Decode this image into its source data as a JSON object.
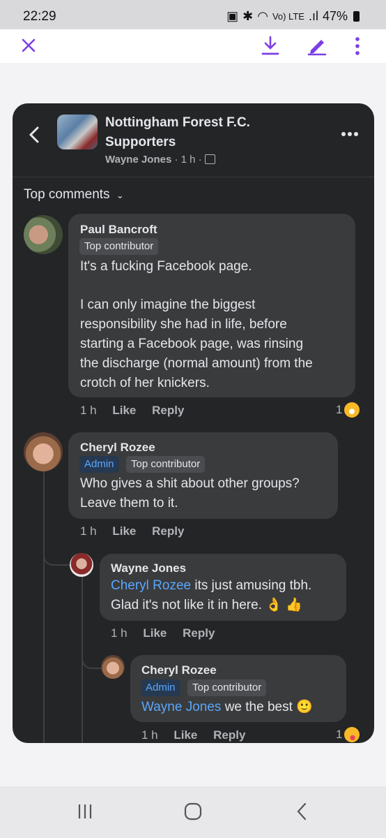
{
  "status_bar": {
    "time": "22:29",
    "network": "Vo) LTE",
    "battery": "47%"
  },
  "viewer_toolbar": {
    "close_icon": "close-icon",
    "download_icon": "download-icon",
    "edit_icon": "pencil-icon",
    "more_icon": "vertical-dots-icon",
    "accent_color": "#7b3fe4"
  },
  "post_header": {
    "group_name_line1": "Nottingham Forest F.C.",
    "group_name_line2": "Supporters",
    "author": "Wayne Jones",
    "time": "1 h",
    "separator": "·"
  },
  "sort": {
    "label": "Top comments"
  },
  "comments": [
    {
      "name": "Paul Bancroft",
      "badges": [
        "Top contributor"
      ],
      "lines": [
        "It's a fucking Facebook page.",
        "",
        "I can only imagine the biggest",
        "responsibility she had in life, before",
        "starting a Facebook page, was rinsing",
        "the discharge (normal amount) from the",
        "crotch of her knickers."
      ],
      "time": "1 h",
      "like": "Like",
      "reply": "Reply",
      "reaction_count": "1"
    },
    {
      "name": "Cheryl Rozee",
      "badges": [
        "Admin",
        "Top contributor"
      ],
      "lines": [
        "Who gives a shit about other groups?",
        "Leave them to it."
      ],
      "time": "1 h",
      "like": "Like",
      "reply": "Reply"
    },
    {
      "name": "Wayne Jones",
      "mention": "Cheryl Rozee",
      "line1_rest": " its just amusing tbh.",
      "line2": "Glad it's not like it in here.",
      "emojis": "👌 👍",
      "time": "1 h",
      "like": "Like",
      "reply": "Reply"
    },
    {
      "name": "Cheryl Rozee",
      "badges": [
        "Admin",
        "Top contributor"
      ],
      "mention": "Wayne Jones",
      "line1_rest": " we the best",
      "emoji": "🙂",
      "time": "1 h",
      "like": "Like",
      "reply": "Reply",
      "reaction_count": "1"
    }
  ],
  "nav_bar": {
    "recents_icon": "recents-icon",
    "home_icon": "home-icon",
    "back_icon": "back-icon"
  }
}
